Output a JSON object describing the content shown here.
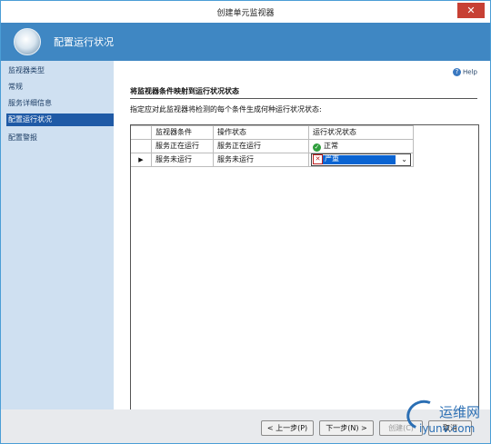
{
  "window": {
    "title": "创建单元监视器",
    "close_glyph": "✕"
  },
  "banner": {
    "title": "配置运行状况",
    "icon": "wizard-circle-icon"
  },
  "sidebar": {
    "items": [
      {
        "label": "监视器类型"
      },
      {
        "label": "常规"
      },
      {
        "label": "服务详细信息"
      },
      {
        "label": "配置运行状况"
      },
      {
        "label": "配置警报"
      }
    ],
    "active_index": 3
  },
  "content": {
    "help_label": "Help",
    "section_title": "将监视器条件映射到运行状况状态",
    "instruction": "指定应对此监视器将检测的每个条件生成何种运行状况状态:",
    "table": {
      "headers": [
        "监视器条件",
        "操作状态",
        "运行状况状态"
      ],
      "rows": [
        {
          "marker": "",
          "condition": "服务正在运行",
          "operation": "服务正在运行",
          "health": "正常",
          "health_icon": "check-icon"
        },
        {
          "marker": "▶",
          "condition": "服务未运行",
          "operation": "服务未运行",
          "health": "严重",
          "health_icon": "error-icon"
        }
      ]
    }
  },
  "buttons": {
    "prev": "< 上一步(P)",
    "next": "下一步(N) >",
    "create": "创建(C)",
    "cancel": "取消"
  },
  "watermark": {
    "line1": "运维网",
    "line2": "iyunv.com"
  },
  "colors": {
    "banner": "#3f87c3",
    "sidebar": "#cfe0f1",
    "active_nav": "#1f5aa6",
    "selection": "#0a64d2",
    "close": "#c74034"
  }
}
